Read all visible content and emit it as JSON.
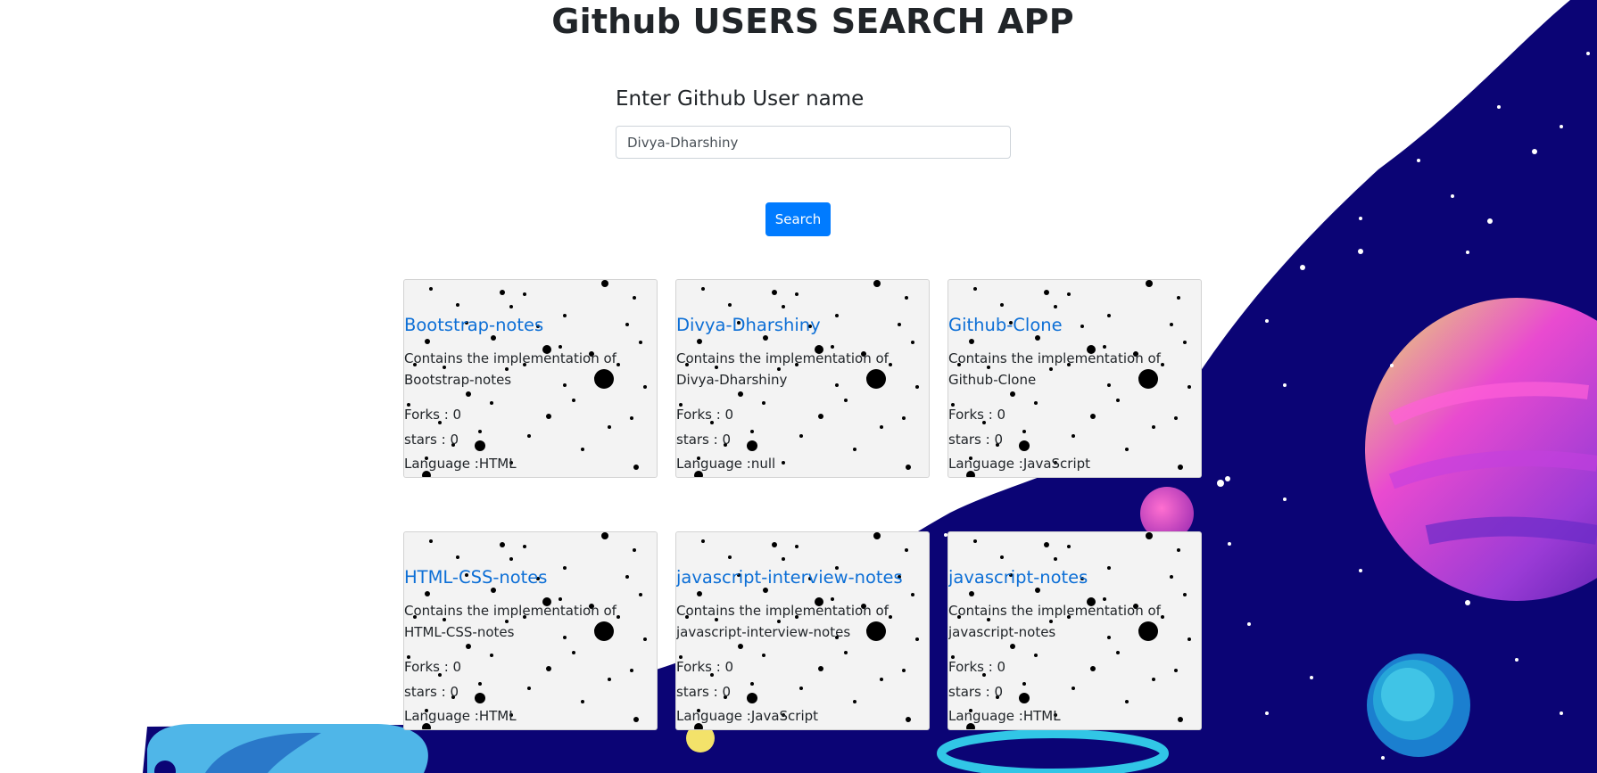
{
  "app": {
    "title": "Github USERS SEARCH APP"
  },
  "search": {
    "label": "Enter Github User name",
    "value": "Divya-Dharshiny",
    "button_label": "Search"
  },
  "repos": [
    {
      "name": "Bootstrap-notes",
      "description": "Contains the implementation of Bootstrap-notes",
      "forks": "Forks : 0",
      "stars": "stars : 0",
      "language": "Language :HTML"
    },
    {
      "name": "Divya-Dharshiny",
      "description": "Contains the implementation of Divya-Dharshiny",
      "forks": "Forks : 0",
      "stars": "stars : 0",
      "language": "Language :null"
    },
    {
      "name": "Github-Clone",
      "description": "Contains the implementation of Github-Clone",
      "forks": "Forks : 0",
      "stars": "stars : 0",
      "language": "Language :JavaScript"
    },
    {
      "name": "HTML-CSS-notes",
      "description": "Contains the implementation of HTML-CSS-notes",
      "forks": "Forks : 0",
      "stars": "stars : 0",
      "language": "Language :HTML"
    },
    {
      "name": "javascript-interview-notes",
      "description": "Contains the implementation of javascript-interview-notes",
      "forks": "Forks : 0",
      "stars": "stars : 0",
      "language": "Language :JavaScript"
    },
    {
      "name": "javascript-notes",
      "description": "Contains the implementation of javascript-notes",
      "forks": "Forks : 0",
      "stars": "stars : 0",
      "language": "Language :HTML"
    }
  ],
  "colors": {
    "space": "#0b0475",
    "accent": "#007bff",
    "link": "#0d6fd6",
    "card": "#f3f3f3"
  }
}
